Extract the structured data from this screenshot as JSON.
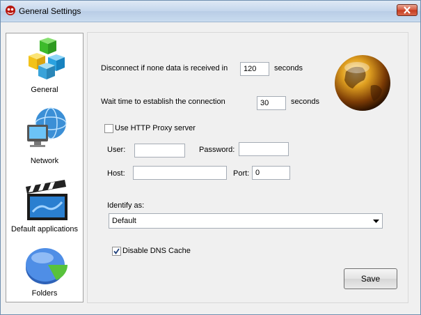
{
  "window": {
    "title": "General Settings",
    "app_icon": "app-logo-icon",
    "close_icon": "close-icon"
  },
  "sidebar": {
    "items": [
      {
        "label": "General",
        "icon": "cubes-icon"
      },
      {
        "label": "Network",
        "icon": "network-globe-icon"
      },
      {
        "label": "Default applications",
        "icon": "clapperboard-icon"
      },
      {
        "label": "Folders",
        "icon": "pie-chart-icon"
      }
    ]
  },
  "general": {
    "disconnect_label": "Disconnect if none data is received in",
    "disconnect_value": "120",
    "disconnect_unit": "seconds",
    "wait_label": "Wait time to establish the connection",
    "wait_value": "30",
    "wait_unit": "seconds",
    "proxy_checkbox_label": "Use HTTP Proxy server",
    "proxy_checked": false,
    "user_label": "User:",
    "user_value": "",
    "password_label": "Password:",
    "password_value": "",
    "host_label": "Host:",
    "host_value": "",
    "port_label": "Port:",
    "port_value": "0",
    "identify_label": "Identify as:",
    "identify_value": "Default",
    "dns_checkbox_label": "Disable DNS Cache",
    "dns_checked": true,
    "save_label": "Save",
    "decoration_icon": "globe-icon"
  }
}
